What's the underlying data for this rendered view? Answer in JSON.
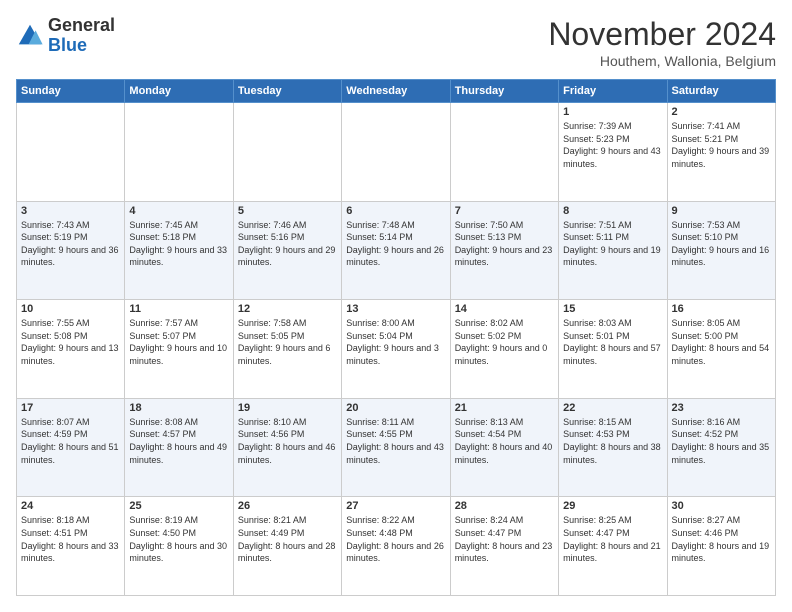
{
  "logo": {
    "general": "General",
    "blue": "Blue"
  },
  "header": {
    "month": "November 2024",
    "location": "Houthem, Wallonia, Belgium"
  },
  "days_of_week": [
    "Sunday",
    "Monday",
    "Tuesday",
    "Wednesday",
    "Thursday",
    "Friday",
    "Saturday"
  ],
  "weeks": [
    [
      {
        "day": "",
        "info": ""
      },
      {
        "day": "",
        "info": ""
      },
      {
        "day": "",
        "info": ""
      },
      {
        "day": "",
        "info": ""
      },
      {
        "day": "",
        "info": ""
      },
      {
        "day": "1",
        "info": "Sunrise: 7:39 AM\nSunset: 5:23 PM\nDaylight: 9 hours and 43 minutes."
      },
      {
        "day": "2",
        "info": "Sunrise: 7:41 AM\nSunset: 5:21 PM\nDaylight: 9 hours and 39 minutes."
      }
    ],
    [
      {
        "day": "3",
        "info": "Sunrise: 7:43 AM\nSunset: 5:19 PM\nDaylight: 9 hours and 36 minutes."
      },
      {
        "day": "4",
        "info": "Sunrise: 7:45 AM\nSunset: 5:18 PM\nDaylight: 9 hours and 33 minutes."
      },
      {
        "day": "5",
        "info": "Sunrise: 7:46 AM\nSunset: 5:16 PM\nDaylight: 9 hours and 29 minutes."
      },
      {
        "day": "6",
        "info": "Sunrise: 7:48 AM\nSunset: 5:14 PM\nDaylight: 9 hours and 26 minutes."
      },
      {
        "day": "7",
        "info": "Sunrise: 7:50 AM\nSunset: 5:13 PM\nDaylight: 9 hours and 23 minutes."
      },
      {
        "day": "8",
        "info": "Sunrise: 7:51 AM\nSunset: 5:11 PM\nDaylight: 9 hours and 19 minutes."
      },
      {
        "day": "9",
        "info": "Sunrise: 7:53 AM\nSunset: 5:10 PM\nDaylight: 9 hours and 16 minutes."
      }
    ],
    [
      {
        "day": "10",
        "info": "Sunrise: 7:55 AM\nSunset: 5:08 PM\nDaylight: 9 hours and 13 minutes."
      },
      {
        "day": "11",
        "info": "Sunrise: 7:57 AM\nSunset: 5:07 PM\nDaylight: 9 hours and 10 minutes."
      },
      {
        "day": "12",
        "info": "Sunrise: 7:58 AM\nSunset: 5:05 PM\nDaylight: 9 hours and 6 minutes."
      },
      {
        "day": "13",
        "info": "Sunrise: 8:00 AM\nSunset: 5:04 PM\nDaylight: 9 hours and 3 minutes."
      },
      {
        "day": "14",
        "info": "Sunrise: 8:02 AM\nSunset: 5:02 PM\nDaylight: 9 hours and 0 minutes."
      },
      {
        "day": "15",
        "info": "Sunrise: 8:03 AM\nSunset: 5:01 PM\nDaylight: 8 hours and 57 minutes."
      },
      {
        "day": "16",
        "info": "Sunrise: 8:05 AM\nSunset: 5:00 PM\nDaylight: 8 hours and 54 minutes."
      }
    ],
    [
      {
        "day": "17",
        "info": "Sunrise: 8:07 AM\nSunset: 4:59 PM\nDaylight: 8 hours and 51 minutes."
      },
      {
        "day": "18",
        "info": "Sunrise: 8:08 AM\nSunset: 4:57 PM\nDaylight: 8 hours and 49 minutes."
      },
      {
        "day": "19",
        "info": "Sunrise: 8:10 AM\nSunset: 4:56 PM\nDaylight: 8 hours and 46 minutes."
      },
      {
        "day": "20",
        "info": "Sunrise: 8:11 AM\nSunset: 4:55 PM\nDaylight: 8 hours and 43 minutes."
      },
      {
        "day": "21",
        "info": "Sunrise: 8:13 AM\nSunset: 4:54 PM\nDaylight: 8 hours and 40 minutes."
      },
      {
        "day": "22",
        "info": "Sunrise: 8:15 AM\nSunset: 4:53 PM\nDaylight: 8 hours and 38 minutes."
      },
      {
        "day": "23",
        "info": "Sunrise: 8:16 AM\nSunset: 4:52 PM\nDaylight: 8 hours and 35 minutes."
      }
    ],
    [
      {
        "day": "24",
        "info": "Sunrise: 8:18 AM\nSunset: 4:51 PM\nDaylight: 8 hours and 33 minutes."
      },
      {
        "day": "25",
        "info": "Sunrise: 8:19 AM\nSunset: 4:50 PM\nDaylight: 8 hours and 30 minutes."
      },
      {
        "day": "26",
        "info": "Sunrise: 8:21 AM\nSunset: 4:49 PM\nDaylight: 8 hours and 28 minutes."
      },
      {
        "day": "27",
        "info": "Sunrise: 8:22 AM\nSunset: 4:48 PM\nDaylight: 8 hours and 26 minutes."
      },
      {
        "day": "28",
        "info": "Sunrise: 8:24 AM\nSunset: 4:47 PM\nDaylight: 8 hours and 23 minutes."
      },
      {
        "day": "29",
        "info": "Sunrise: 8:25 AM\nSunset: 4:47 PM\nDaylight: 8 hours and 21 minutes."
      },
      {
        "day": "30",
        "info": "Sunrise: 8:27 AM\nSunset: 4:46 PM\nDaylight: 8 hours and 19 minutes."
      }
    ]
  ]
}
